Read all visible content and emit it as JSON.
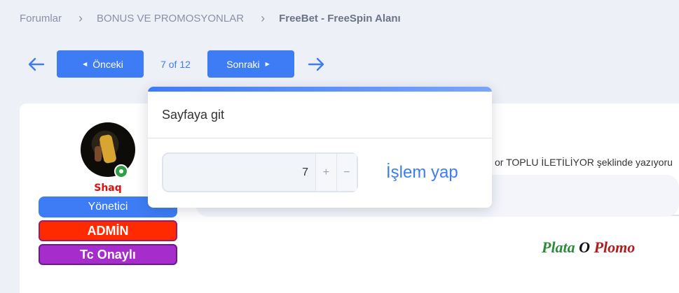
{
  "breadcrumb": {
    "items": [
      "Forumlar",
      "BONUS VE PROMOSYONLAR",
      "FreeBet - FreeSpin Alanı"
    ]
  },
  "pager": {
    "prev_label": "Önceki",
    "next_label": "Sonraki",
    "page_text": "7 of 12"
  },
  "post": {
    "username": "Shaq",
    "role": "Yönetici",
    "badges": [
      "ADMİN",
      "Tc Onaylı"
    ],
    "message_fragment": "or TOPLU İLETİLİYOR şeklinde yazıyoru",
    "signature": [
      "Plata",
      "O",
      "Plomo"
    ]
  },
  "goto_popup": {
    "title": "Sayfaya git",
    "value": "7",
    "inc": "+",
    "dec": "−",
    "submit_label": "İşlem yap"
  },
  "colors": {
    "accent": "#3d7cf4",
    "admin_badge": "#ff2a00",
    "verified_badge": "#a62ccc",
    "username": "#e01010"
  }
}
